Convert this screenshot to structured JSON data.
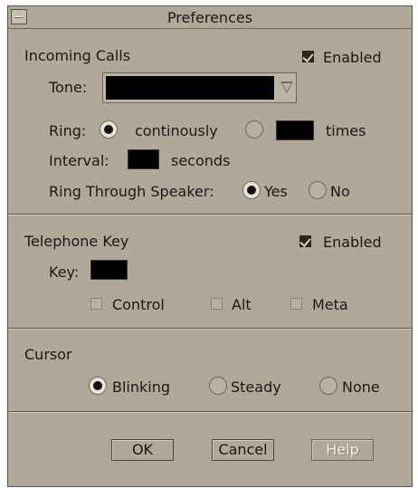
{
  "window": {
    "title": "Preferences"
  },
  "incoming_calls": {
    "heading": "Incoming Calls",
    "enabled_label": "Enabled",
    "enabled": true,
    "tone_label": "Tone:",
    "tone_value": "",
    "ring_label": "Ring:",
    "ring_continuously_label": "continously",
    "ring_mode": "continuously",
    "ring_times_value": "",
    "ring_times_label": "times",
    "interval_label": "Interval:",
    "interval_value": "",
    "interval_unit": "seconds",
    "speaker_label": "Ring Through Speaker:",
    "speaker_yes": "Yes",
    "speaker_no": "No",
    "speaker_value": "Yes"
  },
  "telephone_key": {
    "heading": "Telephone Key",
    "enabled_label": "Enabled",
    "enabled": true,
    "key_label": "Key:",
    "key_value": "",
    "control_label": "Control",
    "alt_label": "Alt",
    "meta_label": "Meta",
    "control": false,
    "alt": false,
    "meta": false
  },
  "cursor": {
    "heading": "Cursor",
    "blinking_label": "Blinking",
    "steady_label": "Steady",
    "none_label": "None",
    "value": "Blinking"
  },
  "buttons": {
    "ok": "OK",
    "cancel": "Cancel",
    "help": "Help"
  },
  "colors": {
    "panel": "#b0a898",
    "field": "#000000",
    "text": "#1a1a1a"
  }
}
